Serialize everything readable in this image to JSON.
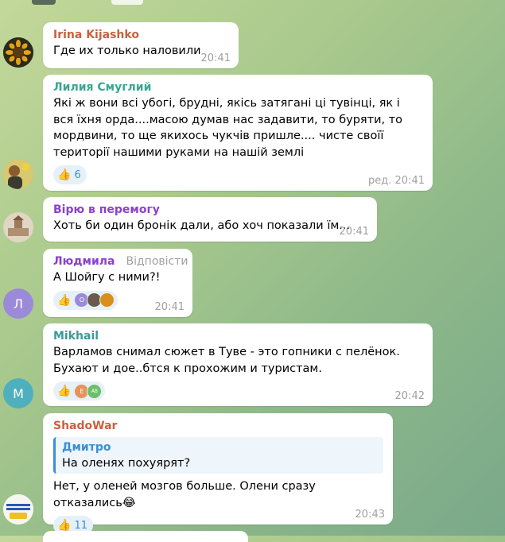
{
  "messages": [
    {
      "name": "Irina Kijashko",
      "name_color": "#c7613f",
      "text": "Где их только наловили",
      "time": "20:41"
    },
    {
      "name": "Лилия Смуглий",
      "name_color": "#3aa78f",
      "text": "Які ж вони всі убогі, брудні, якісь затягані ці тувінці, як і вся їхня орда....масою думав нас задавити, то буряти, то мордвини, то ще якихось чукчів пришле.... чисте своїї території нашими руками на нашій землі",
      "reaction_count": "6",
      "time": "ред. 20:41"
    },
    {
      "name": "Вірю в перемогу",
      "name_color": "#8a3fd1",
      "text": "Хоть би один бронік дали, або хоч показали їм...",
      "time": "20:41"
    },
    {
      "name": "Людмила",
      "name_color": "#8a3fd1",
      "reply_label": "Відповісти",
      "text": "А Шойгу с ними?!",
      "avatar_letter": "Л",
      "mini_letter": "O",
      "time": "20:41"
    },
    {
      "name": "Mikhail",
      "name_color": "#3a9a9a",
      "text": "Варламов снимал сюжет в Туве - это гопники с пелёнок. Бухают и дое..бтся к прохожим и туристам.",
      "avatar_letter": "M",
      "mini_letter_1": "E",
      "mini_letter_2": "AB",
      "time": "20:42"
    },
    {
      "name": "ShadoWar",
      "name_color": "#c7613f",
      "quote_name": "Дмитро",
      "quote_text": "На оленях похуярят?",
      "text": "Нет, у оленей мозгов больше. Олени сразу отказались😂",
      "reaction_count": "11",
      "time": "20:43"
    }
  ],
  "colors": {
    "accent": "#3a8fd6",
    "avatar_l": "#9a8ad8",
    "avatar_m": "#4fb0bd"
  },
  "icons": {
    "reaction": "thumbs-up-icon"
  }
}
